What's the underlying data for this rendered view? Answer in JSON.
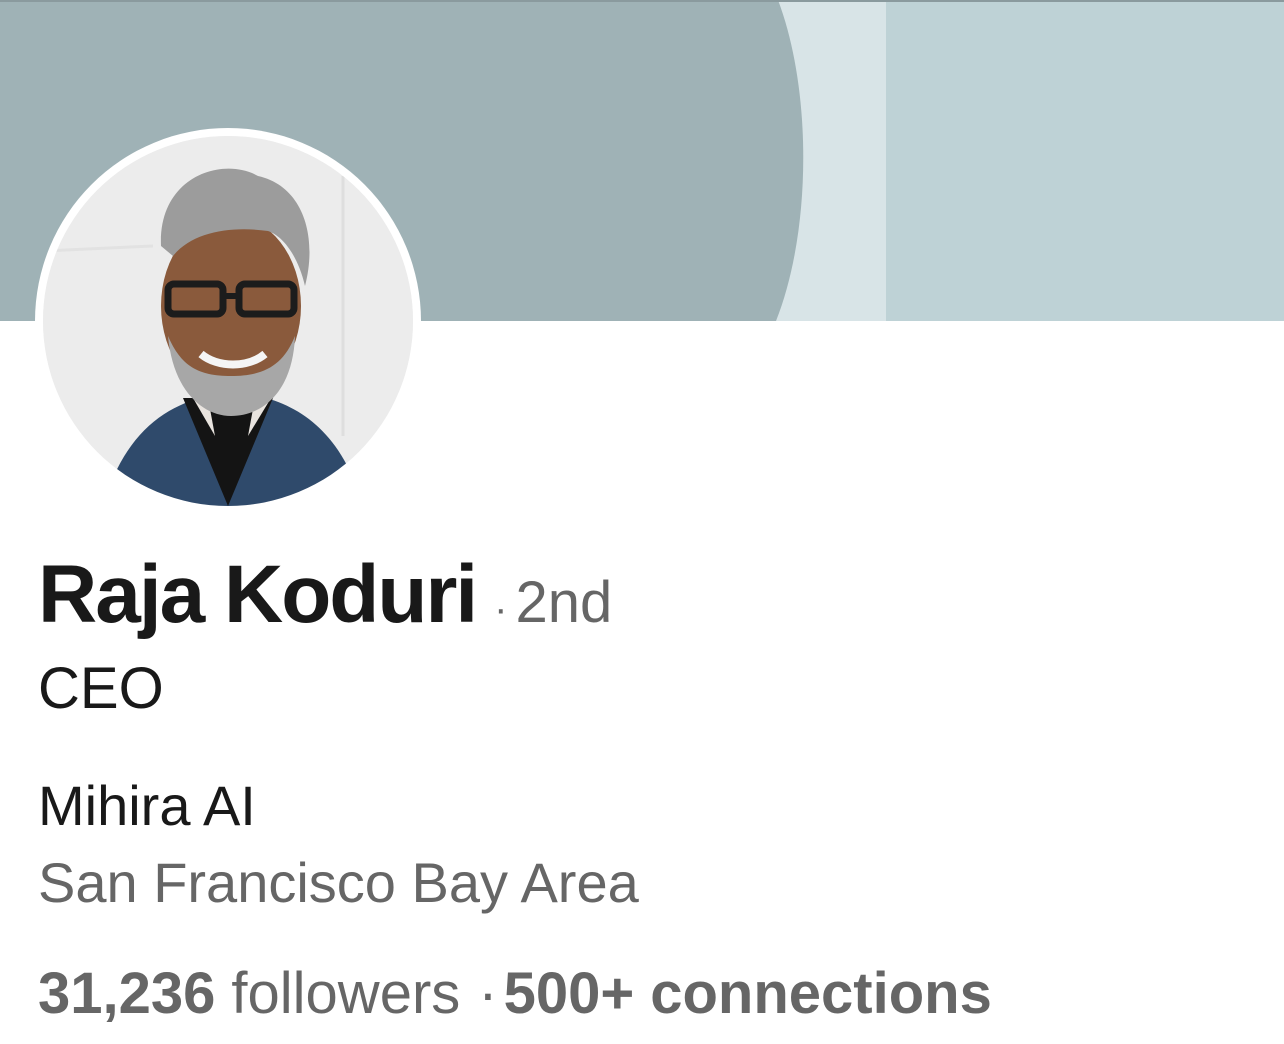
{
  "profile": {
    "name": "Raja Koduri",
    "degree_separator": "·",
    "degree": "2nd",
    "headline": "CEO",
    "company": "Mihira AI",
    "location": "San Francisco Bay Area",
    "followers_count": "31,236",
    "followers_label": "followers",
    "stats_separator": "·",
    "connections_count": "500+",
    "connections_label": "connections"
  },
  "colors": {
    "cover_left": "#9fb2b6",
    "cover_band": "#d8e4e7",
    "cover_right": "#bed2d6",
    "name_text": "#191919",
    "secondary_text": "#666666"
  },
  "icons": {
    "avatar": "profile-photo"
  }
}
